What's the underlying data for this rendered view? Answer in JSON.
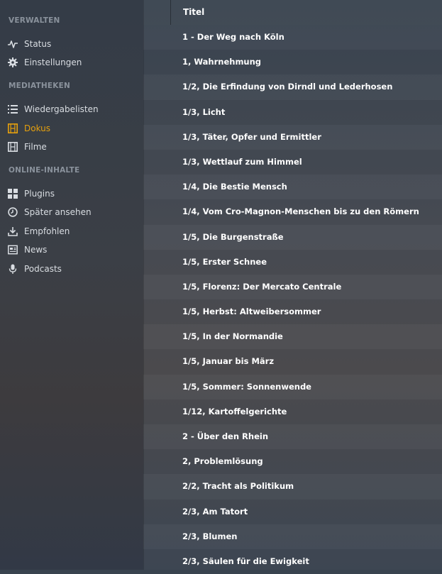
{
  "sidebar": {
    "sections": [
      {
        "header": "Verwalten",
        "items": [
          {
            "label": "Status",
            "icon": "activity-icon"
          },
          {
            "label": "Einstellungen",
            "icon": "gear-icon"
          }
        ]
      },
      {
        "header": "Mediatheken",
        "items": [
          {
            "label": "Wiedergabelisten",
            "icon": "list-icon"
          },
          {
            "label": "Dokus",
            "icon": "film-icon",
            "active": true
          },
          {
            "label": "Filme",
            "icon": "film-icon"
          }
        ]
      },
      {
        "header": "Online-Inhalte",
        "items": [
          {
            "label": "Plugins",
            "icon": "grid-icon"
          },
          {
            "label": "Später ansehen",
            "icon": "clock-icon"
          },
          {
            "label": "Empfohlen",
            "icon": "download-icon"
          },
          {
            "label": "News",
            "icon": "newspaper-icon"
          },
          {
            "label": "Podcasts",
            "icon": "microphone-icon"
          }
        ]
      }
    ]
  },
  "table": {
    "column_title": "Titel",
    "rows": [
      "1 - Der Weg nach Köln",
      "1, Wahrnehmung",
      "1/2, Die Erfindung von Dirndl und Lederhosen",
      "1/3, Licht",
      "1/3, Täter, Opfer und Ermittler",
      "1/3, Wettlauf zum Himmel",
      "1/4, Die Bestie Mensch",
      "1/4, Vom Cro-Magnon-Menschen bis zu den Römern",
      "1/5, Die Burgenstraße",
      "1/5, Erster Schnee",
      "1/5, Florenz: Der Mercato Centrale",
      "1/5, Herbst: Altweibersommer",
      "1/5, In der Normandie",
      "1/5, Januar bis März",
      "1/5, Sommer: Sonnenwende",
      "1/12, Kartoffelgerichte",
      "2 - Über den Rhein",
      "2, Problemlösung",
      "2/2, Tracht als Politikum",
      "2/3, Am Tatort",
      "2/3, Blumen",
      "2/3, Säulen für die Ewigkeit"
    ]
  },
  "colors": {
    "accent": "#e5a00d",
    "section_header": "#8a929c",
    "nav_text": "#d9dde2"
  }
}
